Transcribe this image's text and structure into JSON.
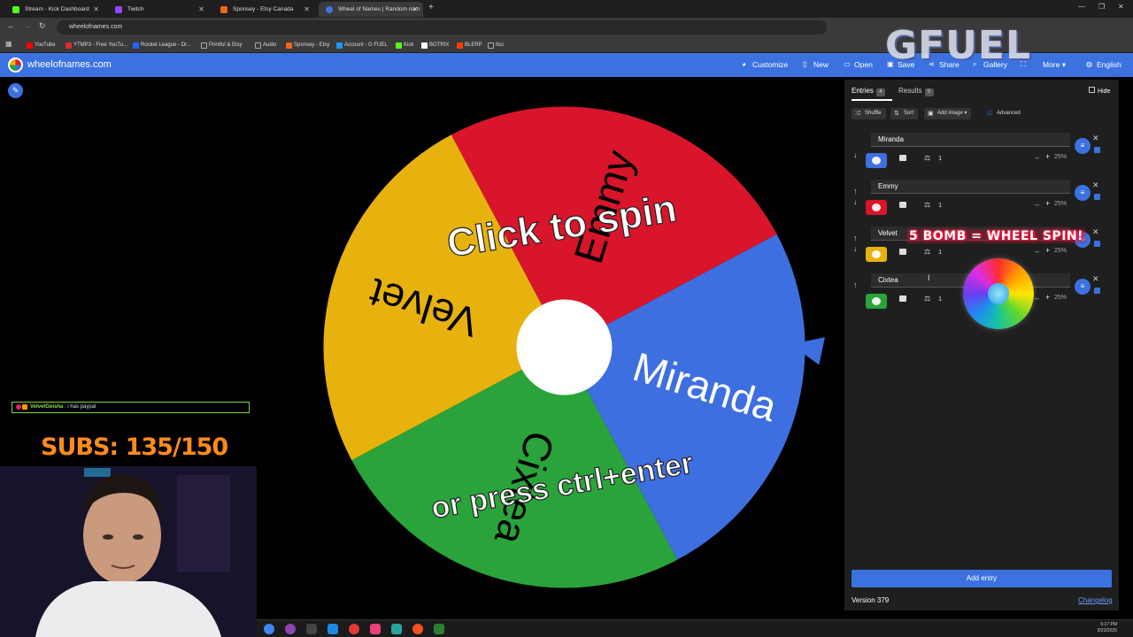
{
  "browser": {
    "tabs": [
      {
        "label": "Stream - Kick Dashboard",
        "color": "#53fc18",
        "active": false
      },
      {
        "label": "Twitch",
        "color": "#9146ff",
        "active": false
      },
      {
        "label": "Sponsey - Etsy Canada",
        "color": "#f1641e",
        "active": false
      },
      {
        "label": "Wheel of Names | Random nam",
        "color": "#3b72e0",
        "active": true
      }
    ],
    "url": "wheelofnames.com",
    "bookmarks": [
      {
        "label": "YouTube",
        "color": "#ff0000"
      },
      {
        "label": "YTMP3 - Free YouTu...",
        "color": "#d32f2f"
      },
      {
        "label": "Rocket League - Dr...",
        "color": "#2962ff"
      },
      {
        "label": "Printful & Etsy",
        "color": "#aaaaaa"
      },
      {
        "label": "Audio",
        "color": "#aaaaaa"
      },
      {
        "label": "Sponsey - Etsy",
        "color": "#f1641e"
      },
      {
        "label": "Account - G FUEL",
        "color": "#2196f3"
      },
      {
        "label": "Kick",
        "color": "#53fc18"
      },
      {
        "label": "BOTRIX",
        "color": "#ffffff"
      },
      {
        "label": "BLERP",
        "color": "#ff3d00"
      },
      {
        "label": "ttcc",
        "color": "#aaaaaa"
      }
    ]
  },
  "header": {
    "site_name": "wheelofnames.com",
    "buttons": [
      {
        "label": "Customize",
        "icon": "palette-icon"
      },
      {
        "label": "New",
        "icon": "file-icon"
      },
      {
        "label": "Open",
        "icon": "folder-icon"
      },
      {
        "label": "Save",
        "icon": "save-icon"
      },
      {
        "label": "Share",
        "icon": "share-icon"
      },
      {
        "label": "Gallery",
        "icon": "search-icon"
      },
      {
        "label": "",
        "icon": "fullscreen-icon"
      },
      {
        "label": "More",
        "icon": "chevron-down-icon"
      },
      {
        "label": "English",
        "icon": "globe-icon"
      }
    ]
  },
  "overlay": {
    "gfuel": "GFUEL",
    "bomb": "5 BOMB = WHEEL SPIN!",
    "chat_user": "VelvetGeisha",
    "chat_message": "i has paypal",
    "subs": "SUBS: 135/150"
  },
  "wheel": {
    "center_text_top": "Click to spin",
    "center_text_bottom": "or press ctrl+enter",
    "slices": [
      {
        "name": "Miranda",
        "color": "#3e6fe0"
      },
      {
        "name": "Emmy",
        "color": "#d8152b"
      },
      {
        "name": "Velvet",
        "color": "#e8b20e"
      },
      {
        "name": "Cixtea",
        "color": "#2aa43a"
      }
    ]
  },
  "panel": {
    "tab_entries": "Entries",
    "entries_count": "4",
    "tab_results": "Results",
    "results_count": "0",
    "hide_label": "Hide",
    "shuffle_label": "Shuffle",
    "sort_label": "Sort",
    "add_image_label": "Add image",
    "advanced_label": "Advanced",
    "entries": [
      {
        "name": "Miranda",
        "color": "#3e6fe0",
        "weight": "1",
        "percent": "25%"
      },
      {
        "name": "Emmy",
        "color": "#d8152b",
        "weight": "1",
        "percent": "25%"
      },
      {
        "name": "Velvet",
        "color": "#e8b20e",
        "weight": "1",
        "percent": "25%"
      },
      {
        "name": "Cixtea",
        "color": "#2aa43a",
        "weight": "1",
        "percent": "25%"
      }
    ],
    "add_entry_label": "Add entry",
    "version": "Version 379",
    "changelog": "Changelog"
  },
  "taskbar": {
    "time": "6:17 PM",
    "date": "9/23/2025"
  }
}
